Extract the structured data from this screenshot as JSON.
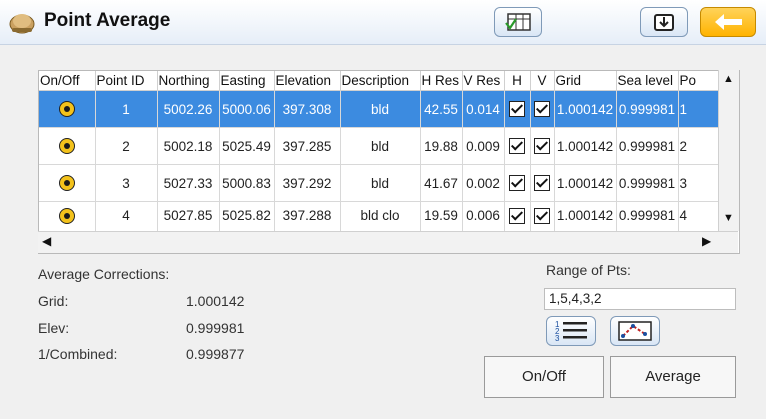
{
  "title": "Point Average",
  "toolbar": {
    "map_icon": "map-table-icon",
    "import_icon": "import-icon",
    "back_icon": "back-arrow-icon"
  },
  "table": {
    "columns": [
      "On/Off",
      "Point ID",
      "Northing",
      "Easting",
      "Elevation",
      "Description",
      "H Res",
      "V Res",
      "H",
      "V",
      "Grid",
      "Sea level",
      "Po"
    ],
    "rows": [
      {
        "point_id": "1",
        "northing": "5002.26",
        "easting": "5000.06",
        "elevation": "397.308",
        "description": "bld",
        "h_res": "42.55",
        "v_res": "0.014",
        "grid": "1.000142",
        "sea_level": "0.999981",
        "po": "1",
        "selected": true
      },
      {
        "point_id": "2",
        "northing": "5002.18",
        "easting": "5025.49",
        "elevation": "397.285",
        "description": "bld",
        "h_res": "19.88",
        "v_res": "0.009",
        "grid": "1.000142",
        "sea_level": "0.999981",
        "po": "2",
        "selected": false
      },
      {
        "point_id": "3",
        "northing": "5027.33",
        "easting": "5000.83",
        "elevation": "397.292",
        "description": "bld",
        "h_res": "41.67",
        "v_res": "0.002",
        "grid": "1.000142",
        "sea_level": "0.999981",
        "po": "3",
        "selected": false
      },
      {
        "point_id": "4",
        "northing": "5027.85",
        "easting": "5025.82",
        "elevation": "397.288",
        "description": "bld clo",
        "h_res": "19.59",
        "v_res": "0.006",
        "grid": "1.000142",
        "sea_level": "0.999981",
        "po": "4",
        "selected": false
      }
    ]
  },
  "average": {
    "heading": "Average Corrections:",
    "grid_label": "Grid:",
    "grid_value": "1.000142",
    "elev_label": "Elev:",
    "elev_value": "0.999981",
    "combined_label": "1/Combined:",
    "combined_value": "0.999877"
  },
  "range": {
    "label": "Range of Pts:",
    "value": "1,5,4,3,2"
  },
  "buttons": {
    "onoff": "On/Off",
    "average": "Average"
  },
  "colors": {
    "selection": "#3c8be0",
    "back_button": "#ffb300"
  }
}
